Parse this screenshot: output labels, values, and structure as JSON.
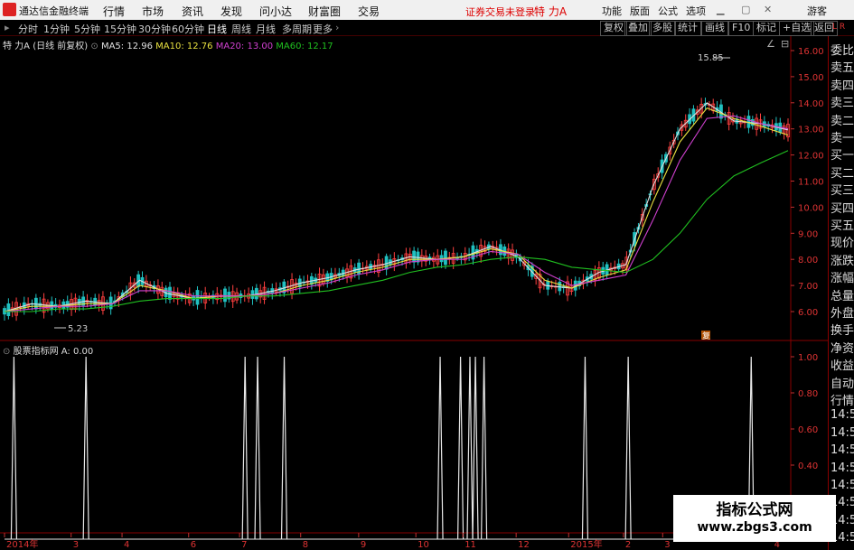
{
  "app": {
    "title": "通达信金融终端",
    "login_status": "证券交易未登录",
    "stock_name": "特 力A"
  },
  "menu": [
    "行情",
    "市场",
    "资讯",
    "发现",
    "问小达",
    "财富圈",
    "交易"
  ],
  "right_menu": [
    "功能",
    "版面",
    "公式",
    "选项",
    "游客"
  ],
  "periods": [
    "分时",
    "1分钟",
    "5分钟",
    "15分钟",
    "30分钟",
    "60分钟",
    "日线",
    "周线",
    "月线",
    "多周期",
    "更多"
  ],
  "active_period": "日线",
  "tools": [
    "复权",
    "叠加",
    "多股",
    "统计",
    "画线",
    "F10",
    "标记",
    "+自选",
    "返回"
  ],
  "main_title": {
    "name": "特 力A (日线 前复权)",
    "ma5": "MA5: 12.96",
    "ma10": "MA10: 12.76",
    "ma20": "MA20: 13.00",
    "ma60": "MA60: 12.17"
  },
  "sub_title": {
    "name": "股票指标网",
    "value": "A: 0.00"
  },
  "annotations": {
    "high": "15.85",
    "low": "5.23",
    "mark": "复"
  },
  "price_axis": [
    "16.00",
    "15.00",
    "14.00",
    "13.00",
    "12.00",
    "11.00",
    "10.00",
    "9.00",
    "8.00",
    "7.00",
    "6.00"
  ],
  "ind_axis": [
    "1.00",
    "0.80",
    "0.60",
    "0.40",
    "0.20"
  ],
  "x_axis": [
    "2014年",
    "3",
    "4",
    "6",
    "7",
    "8",
    "9",
    "10",
    "11",
    "12",
    "2015年",
    "2",
    "3",
    "4"
  ],
  "right_panel": [
    "委比",
    "卖五",
    "卖四",
    "卖三",
    "卖二",
    "卖一",
    "买一",
    "买二",
    "买三",
    "买四",
    "买五",
    "现价",
    "涨跌",
    "涨幅",
    "总量",
    "外盘",
    "换手",
    "净资",
    "收益",
    "自动",
    "行情",
    "14:5",
    "14:5",
    "14:5",
    "14:5",
    "14:5",
    "14:5",
    "14:5",
    "14:5"
  ],
  "panel_corner": "L R",
  "watermark": {
    "title": "指标公式网",
    "url": "www.zbgs3.com"
  },
  "colors": {
    "ma5": "#e0e0e0",
    "ma10": "#e8e040",
    "ma20": "#d040d0",
    "ma60": "#20c020",
    "up": "#ff4040",
    "down": "#20c0c0",
    "axis": "#c03030"
  },
  "chart_data": [
    {
      "type": "line",
      "title": "特 力A (日线 前复权)",
      "x_ticks": [
        "2014年",
        "3",
        "4",
        "6",
        "7",
        "8",
        "9",
        "10",
        "11",
        "12",
        "2015年",
        "2",
        "3",
        "4"
      ],
      "ylim": [
        5,
        16.5
      ],
      "series": [
        {
          "name": "MA5",
          "values": [
            6.0,
            6.3,
            6.2,
            6.4,
            6.3,
            7.2,
            6.7,
            6.5,
            6.6,
            6.6,
            6.8,
            7.1,
            7.3,
            7.6,
            7.8,
            8.1,
            8.0,
            8.1,
            8.5,
            8.1,
            7.0,
            6.9,
            7.5,
            7.8,
            10.8,
            13.0,
            14.0,
            13.3,
            13.2,
            12.96
          ]
        },
        {
          "name": "MA10",
          "values": [
            6.0,
            6.2,
            6.2,
            6.3,
            6.3,
            7.0,
            6.8,
            6.5,
            6.6,
            6.6,
            6.7,
            7.0,
            7.2,
            7.5,
            7.7,
            8.0,
            8.0,
            8.1,
            8.4,
            8.2,
            7.2,
            6.9,
            7.3,
            7.6,
            10.2,
            12.5,
            13.8,
            13.4,
            13.1,
            12.76
          ]
        },
        {
          "name": "MA20",
          "values": [
            6.0,
            6.1,
            6.2,
            6.2,
            6.3,
            6.8,
            6.8,
            6.6,
            6.6,
            6.6,
            6.7,
            6.9,
            7.1,
            7.4,
            7.6,
            7.9,
            8.0,
            8.0,
            8.3,
            8.2,
            7.5,
            7.0,
            7.2,
            7.4,
            9.5,
            11.8,
            13.4,
            13.5,
            13.2,
            13.0
          ]
        },
        {
          "name": "MA60",
          "values": [
            6.0,
            6.0,
            6.1,
            6.1,
            6.2,
            6.4,
            6.5,
            6.5,
            6.5,
            6.6,
            6.6,
            6.7,
            6.8,
            7.0,
            7.2,
            7.5,
            7.7,
            7.8,
            8.0,
            8.1,
            8.0,
            7.7,
            7.6,
            7.5,
            8.0,
            9.0,
            10.3,
            11.2,
            11.7,
            12.17
          ]
        }
      ]
    },
    {
      "type": "line",
      "title": "股票指标网",
      "ylim": [
        0,
        1.05
      ],
      "series": [
        {
          "name": "A",
          "spike_positions": [
            0.012,
            0.104,
            0.307,
            0.323,
            0.357,
            0.556,
            0.582,
            0.594,
            0.601,
            0.612,
            0.741,
            0.796,
            0.953
          ],
          "values_at_spikes": 1.0,
          "last": 0.0
        }
      ]
    }
  ]
}
